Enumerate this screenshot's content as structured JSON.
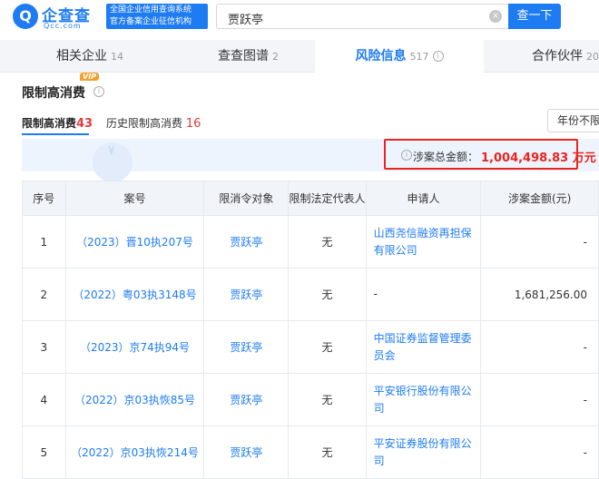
{
  "header": {
    "logo_glyph": "Q",
    "logo_text": "企查查",
    "logo_sub": "Qcc.com",
    "slogan_line1": "全国企业信用查询系统",
    "slogan_line2": "官方备案企业征信机构",
    "search_value": "贾跃亭",
    "clear_icon": "×",
    "search_button": "查一下"
  },
  "tabs": [
    {
      "label": "相关企业",
      "count": "14"
    },
    {
      "label": "查查图谱",
      "count": "2"
    },
    {
      "label": "风险信息",
      "count": "517",
      "active": true
    },
    {
      "label": "合作伙伴",
      "count": "20"
    }
  ],
  "section": {
    "title": "限制高消费",
    "vip": "VIP",
    "info_icon": "i",
    "subtabs": [
      {
        "label": "限制高消费",
        "count": "43"
      },
      {
        "label": "历史限制高消费",
        "count": "16"
      }
    ],
    "year_filter": "年份不限",
    "summary_label": "涉案总金额：",
    "summary_amount": "1,004,498.83 万元",
    "watermark_glyph": "¥"
  },
  "table": {
    "headers": [
      "序号",
      "案号",
      "限消令对象",
      "限制法定代表人",
      "申请人",
      "涉案金额(元)"
    ],
    "rows": [
      {
        "no": "1",
        "case": "（2023）晋10执207号",
        "target": "贾跃亭",
        "rep": "无",
        "applicant_l1": "山西尧信融资再担保",
        "applicant_l2": "有限公司",
        "amount": "-"
      },
      {
        "no": "2",
        "case": "（2022）粤03执3148号",
        "target": "贾跃亭",
        "rep": "无",
        "applicant_l1": "-",
        "applicant_l2": "",
        "amount": "1,681,256.00"
      },
      {
        "no": "3",
        "case": "（2023）京74执94号",
        "target": "贾跃亭",
        "rep": "无",
        "applicant_l1": "中国证券监督管理委",
        "applicant_l2": "员会",
        "amount": "-"
      },
      {
        "no": "4",
        "case": "（2022）京03执恢85号",
        "target": "贾跃亭",
        "rep": "无",
        "applicant_l1": "平安银行股份有限公",
        "applicant_l2": "司",
        "amount": "-"
      },
      {
        "no": "5",
        "case": "（2022）京03执恢214号",
        "target": "贾跃亭",
        "rep": "无",
        "applicant_l1": "平安证券股份有限公",
        "applicant_l2": "司",
        "amount": "-"
      }
    ]
  },
  "colors": {
    "accent": "#1e7cf2",
    "alert": "#e8251d",
    "vip": "#f2a12c"
  },
  "icons": {
    "clear": "clear-icon",
    "info": "info-icon",
    "logo": "qcc-logo-icon"
  }
}
